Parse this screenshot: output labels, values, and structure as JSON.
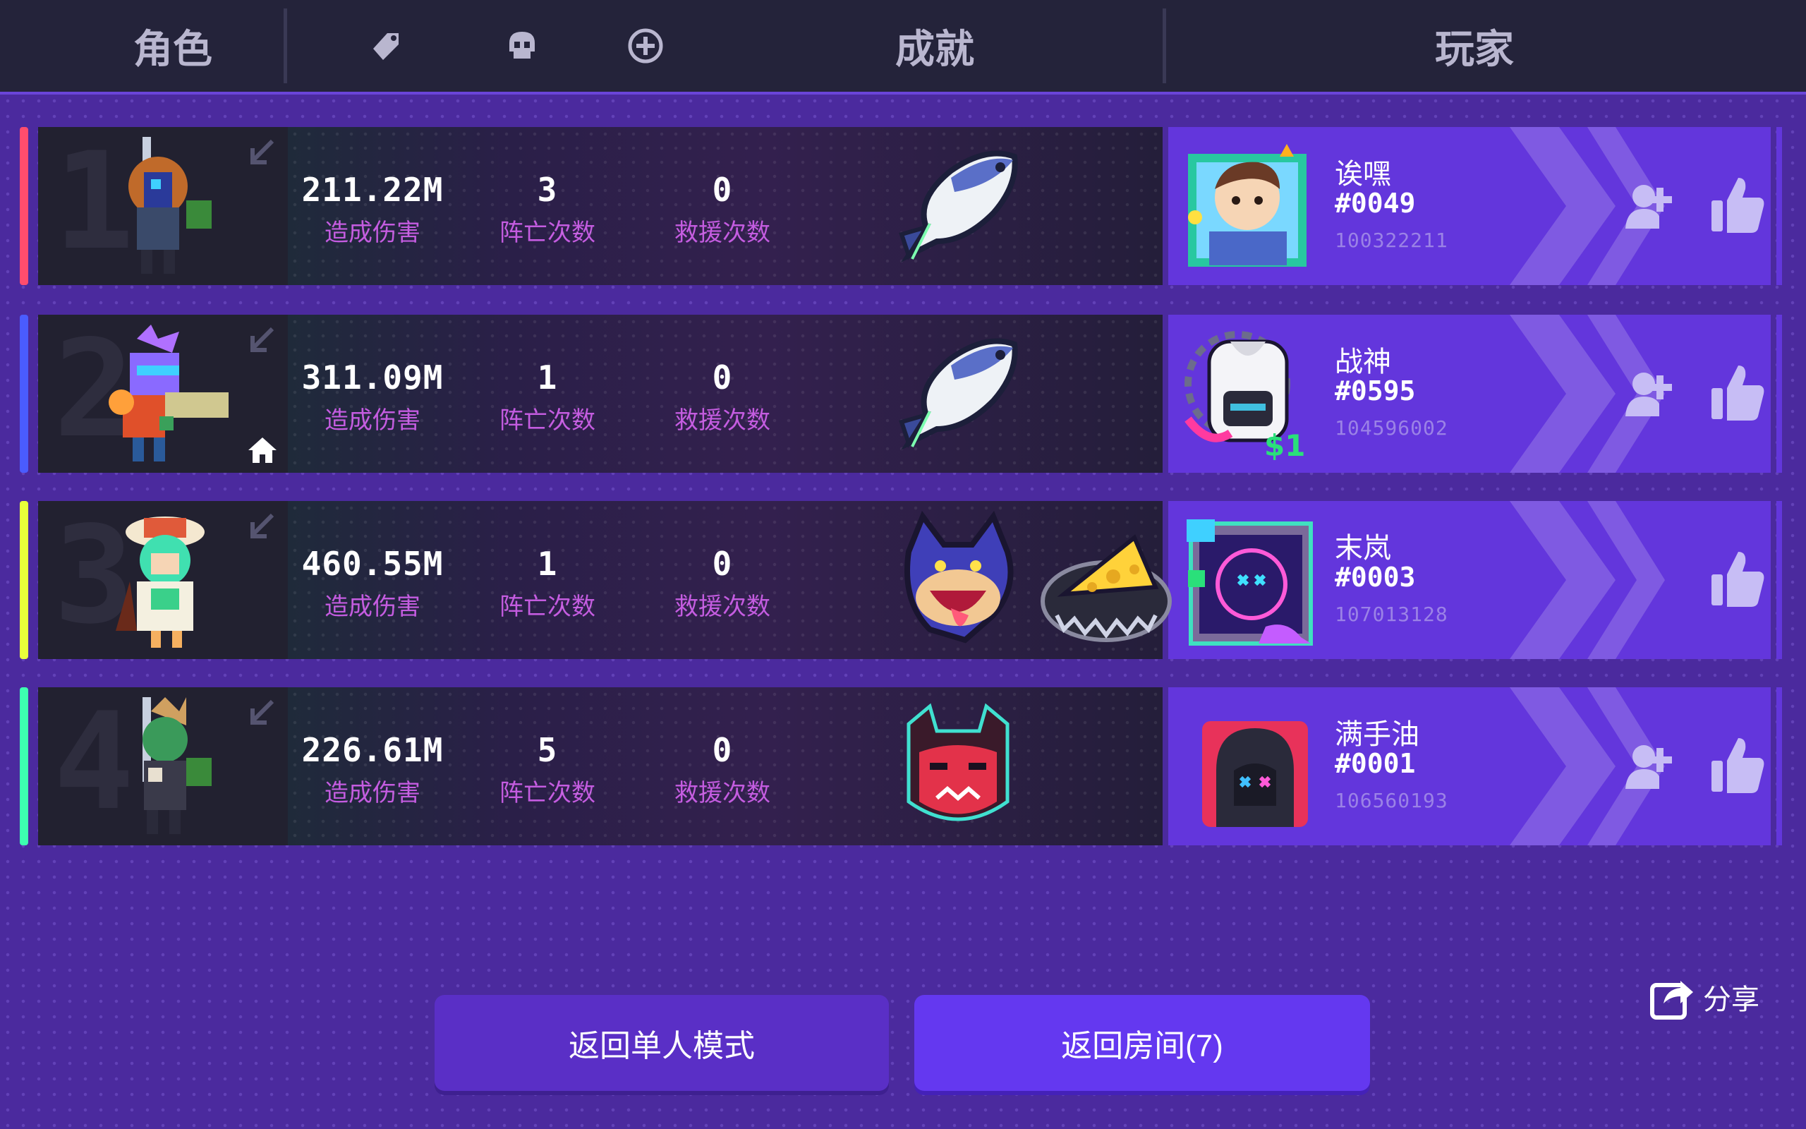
{
  "header": {
    "role_label": "角色",
    "achievement_label": "成就",
    "player_label": "玩家",
    "icons": [
      "tag-icon",
      "skull-icon",
      "plus-circle-icon"
    ]
  },
  "rows": [
    {
      "rank": "1",
      "bar_color": "#ff4d6d",
      "damage": "211.22M",
      "damage_label": "造成伤害",
      "deaths": "3",
      "deaths_label": "阵亡次数",
      "rescues": "0",
      "rescues_label": "救援次数",
      "achievements": [
        "fish-icon"
      ],
      "player": {
        "name": "诶嘿",
        "tag": "#0049",
        "id": "100322211"
      },
      "show_add_friend": true
    },
    {
      "rank": "2",
      "bar_color": "#4a5cff",
      "damage": "311.09M",
      "damage_label": "造成伤害",
      "deaths": "1",
      "deaths_label": "阵亡次数",
      "rescues": "0",
      "rescues_label": "救援次数",
      "achievements": [
        "fish-icon"
      ],
      "player": {
        "name": "战神",
        "tag": "#0595",
        "id": "104596002"
      },
      "show_add_friend": true,
      "host": true
    },
    {
      "rank": "3",
      "bar_color": "#e8ff3a",
      "damage": "460.55M",
      "damage_label": "造成伤害",
      "deaths": "1",
      "deaths_label": "阵亡次数",
      "rescues": "0",
      "rescues_label": "救援次数",
      "achievements": [
        "wolf-icon",
        "cheese-icon"
      ],
      "player": {
        "name": "末岚",
        "tag": "#0003",
        "id": "107013128"
      },
      "show_add_friend": false
    },
    {
      "rank": "4",
      "bar_color": "#3dffb0",
      "damage": "226.61M",
      "damage_label": "造成伤害",
      "deaths": "5",
      "deaths_label": "阵亡次数",
      "rescues": "0",
      "rescues_label": "救援次数",
      "achievements": [
        "demon-icon"
      ],
      "player": {
        "name": "满手油",
        "tag": "#0001",
        "id": "106560193"
      },
      "show_add_friend": true
    }
  ],
  "buttons": {
    "back_single": "返回单人模式",
    "back_room": "返回房间(7)"
  },
  "share_label": "分享"
}
